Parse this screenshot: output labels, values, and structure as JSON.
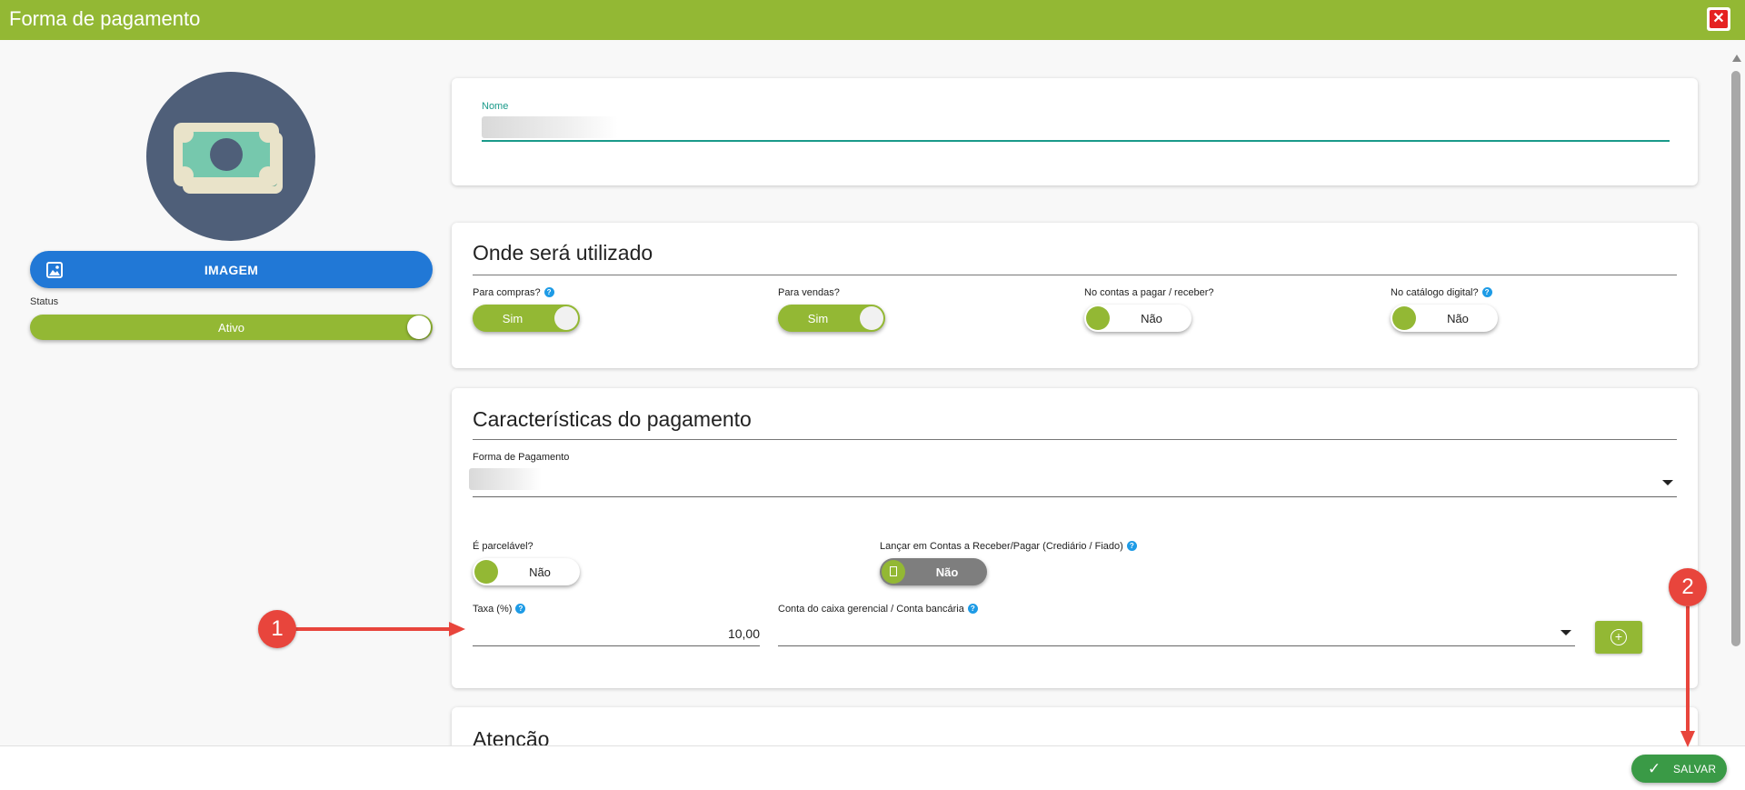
{
  "window": {
    "title": "Forma de pagamento",
    "close_symbol": "✕"
  },
  "sidebar": {
    "image_button_label": "IMAGEM",
    "status": {
      "label": "Status",
      "value": "Ativo"
    }
  },
  "name_card": {
    "label": "Nome",
    "value": ""
  },
  "usage_card": {
    "title": "Onde será utilizado",
    "toggles": [
      {
        "label": "Para compras?",
        "value": "Sim"
      },
      {
        "label": "Para vendas?",
        "value": "Sim"
      },
      {
        "label": "No contas a pagar / receber?",
        "value": "Não"
      },
      {
        "label": "No catálogo digital?",
        "value": "Não"
      }
    ]
  },
  "payment_card": {
    "title": "Características do pagamento",
    "forma_label": "Forma de Pagamento",
    "forma_value": "",
    "parcelavel": {
      "label": "É parcelável?",
      "value": "Não"
    },
    "lancar": {
      "label": "Lançar em Contas a Receber/Pagar (Crediário / Fiado)",
      "value": "Não"
    },
    "taxa": {
      "label": "Taxa (%)",
      "value": "10,00"
    },
    "conta": {
      "label": "Conta do caixa gerencial / Conta bancária",
      "value": ""
    },
    "add_symbol": "+"
  },
  "attention_card": {
    "title": "Atenção"
  },
  "footer": {
    "save_label": "SALVAR",
    "save_icon": "✓"
  },
  "help_symbol": "?",
  "annotations": [
    {
      "label": "1"
    },
    {
      "label": "2"
    }
  ],
  "colors": {
    "header": "#93b834",
    "primary": "#2178d6",
    "save": "#3a9a46",
    "accent_line": "#1a9a8a",
    "annotation": "#e8453c"
  }
}
